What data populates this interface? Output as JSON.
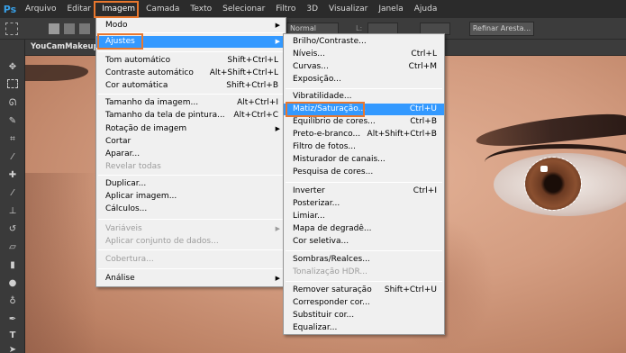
{
  "app": {
    "logo": "Ps"
  },
  "menubar": [
    "Arquivo",
    "Editar",
    "Imagem",
    "Camada",
    "Texto",
    "Selecionar",
    "Filtro",
    "3D",
    "Visualizar",
    "Janela",
    "Ajuda"
  ],
  "options": {
    "mode": "Normal",
    "refine_label": "Refinar Aresta..."
  },
  "document": {
    "tab_label": "YouCamMakeup S"
  },
  "image_menu": [
    {
      "label": "Modo",
      "shortcut": "",
      "submenu": true
    },
    {
      "label": "Ajustes",
      "shortcut": "",
      "submenu": true
    },
    {
      "label": "Tom automático",
      "shortcut": "Shift+Ctrl+L"
    },
    {
      "label": "Contraste automático",
      "shortcut": "Alt+Shift+Ctrl+L"
    },
    {
      "label": "Cor automática",
      "shortcut": "Shift+Ctrl+B"
    },
    {
      "label": "Tamanho da imagem...",
      "shortcut": "Alt+Ctrl+I"
    },
    {
      "label": "Tamanho da tela de pintura...",
      "shortcut": "Alt+Ctrl+C"
    },
    {
      "label": "Rotação de imagem",
      "shortcut": "",
      "submenu": true
    },
    {
      "label": "Cortar",
      "shortcut": ""
    },
    {
      "label": "Aparar...",
      "shortcut": ""
    },
    {
      "label": "Revelar todas",
      "shortcut": "",
      "disabled": true
    },
    {
      "label": "Duplicar...",
      "shortcut": ""
    },
    {
      "label": "Aplicar imagem...",
      "shortcut": ""
    },
    {
      "label": "Cálculos...",
      "shortcut": ""
    },
    {
      "label": "Variáveis",
      "shortcut": "",
      "submenu": true,
      "disabled": true
    },
    {
      "label": "Aplicar conjunto de dados...",
      "shortcut": "",
      "disabled": true
    },
    {
      "label": "Cobertura...",
      "shortcut": "",
      "disabled": true
    },
    {
      "label": "Análise",
      "shortcut": "",
      "submenu": true
    }
  ],
  "adjust_menu": [
    {
      "label": "Brilho/Contraste...",
      "shortcut": ""
    },
    {
      "label": "Níveis...",
      "shortcut": "Ctrl+L"
    },
    {
      "label": "Curvas...",
      "shortcut": "Ctrl+M"
    },
    {
      "label": "Exposição...",
      "shortcut": ""
    },
    {
      "label": "Vibratilidade...",
      "shortcut": ""
    },
    {
      "label": "Matiz/Saturação...",
      "shortcut": "Ctrl+U"
    },
    {
      "label": "Equilíbrio de cores...",
      "shortcut": "Ctrl+B"
    },
    {
      "label": "Preto-e-branco...",
      "shortcut": "Alt+Shift+Ctrl+B"
    },
    {
      "label": "Filtro de fotos...",
      "shortcut": ""
    },
    {
      "label": "Misturador de canais...",
      "shortcut": ""
    },
    {
      "label": "Pesquisa de cores...",
      "shortcut": ""
    },
    {
      "label": "Inverter",
      "shortcut": "Ctrl+I"
    },
    {
      "label": "Posterizar...",
      "shortcut": ""
    },
    {
      "label": "Limiar...",
      "shortcut": ""
    },
    {
      "label": "Mapa de degradê...",
      "shortcut": ""
    },
    {
      "label": "Cor seletiva...",
      "shortcut": ""
    },
    {
      "label": "Sombras/Realces...",
      "shortcut": ""
    },
    {
      "label": "Tonalização HDR...",
      "shortcut": "",
      "disabled": true
    },
    {
      "label": "Remover saturação",
      "shortcut": "Shift+Ctrl+U"
    },
    {
      "label": "Corresponder cor...",
      "shortcut": ""
    },
    {
      "label": "Substituir cor...",
      "shortcut": ""
    },
    {
      "label": "Equalizar...",
      "shortcut": ""
    }
  ],
  "colors": {
    "highlight": "#3399ff",
    "callout": "#e8772e",
    "ps_blue": "#38a0e8"
  }
}
